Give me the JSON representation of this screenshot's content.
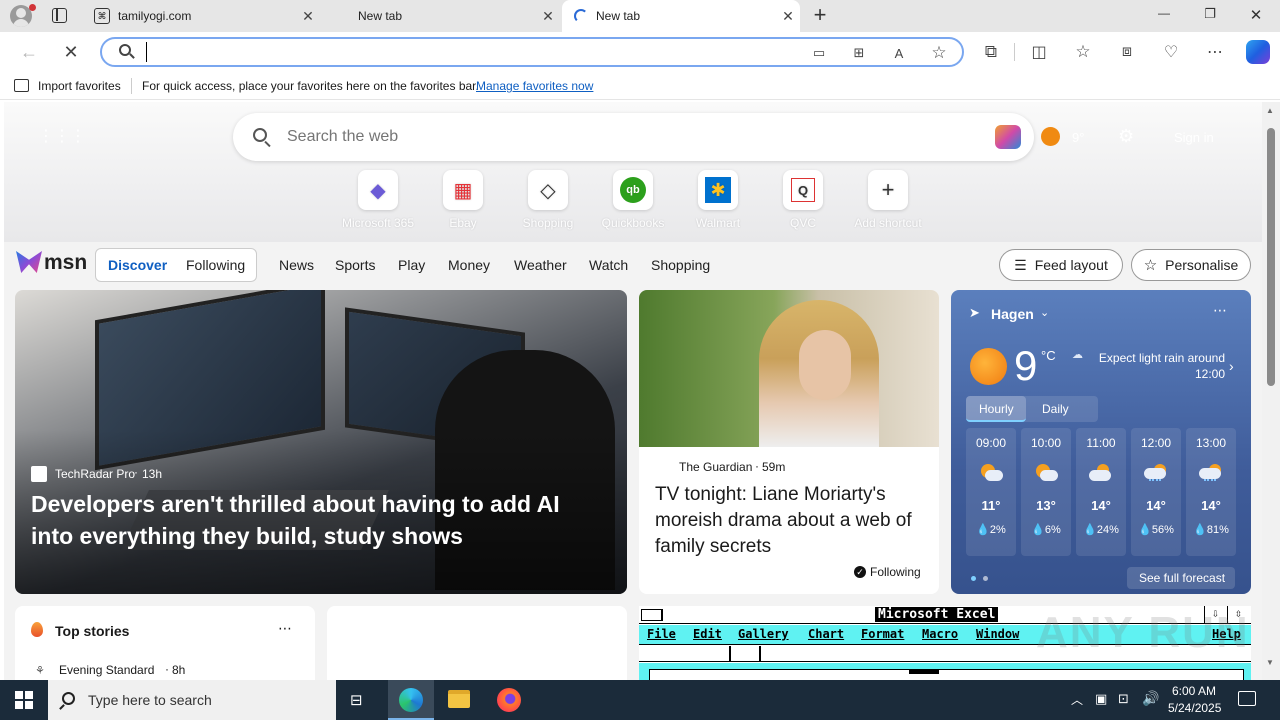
{
  "tabs": [
    {
      "title": "tamilyogi.com"
    },
    {
      "title": "New tab"
    },
    {
      "title": "New tab"
    }
  ],
  "window_controls": {
    "minimize": "—",
    "restore": "❐",
    "close": "✕"
  },
  "address_bar": {
    "value": "",
    "placeholder": ""
  },
  "favorites_bar": {
    "import_label": "Import favorites",
    "hint": "For quick access, place your favorites here on the favorites bar.",
    "manage_link": "Manage favorites now"
  },
  "newtab": {
    "search_placeholder": "Search the web",
    "temp_small": "9°",
    "sign_in": "Sign in",
    "shortcuts": [
      {
        "label": "Microsoft 365",
        "glyph": "◆",
        "color": "#6b5bd6"
      },
      {
        "label": "Ebay",
        "glyph": "▦",
        "color": "#e53238"
      },
      {
        "label": "Shopping",
        "glyph": "◇",
        "color": "#333333"
      },
      {
        "label": "Quickbooks",
        "glyph": "qb",
        "color": "#2ca01c"
      },
      {
        "label": "Walmart",
        "glyph": "✱",
        "color": "#ffc220"
      },
      {
        "label": "QVC",
        "glyph": "Q",
        "color": "#333333"
      },
      {
        "label": "Add shortcut",
        "glyph": "+",
        "color": "#333333"
      }
    ]
  },
  "msn": {
    "logo": "msn",
    "tabs": [
      "Discover",
      "Following"
    ],
    "nav": [
      "News",
      "Sports",
      "Play",
      "Money",
      "Weather",
      "Watch",
      "Shopping"
    ],
    "feed_layout": "Feed layout",
    "personalise": "Personalise"
  },
  "hero_article": {
    "source": "TechRadar Pro",
    "age": "13h",
    "headline": "Developers aren't thrilled about having to add AI into everything they build, study shows"
  },
  "second_article": {
    "source": "The Guardian",
    "age": "59m",
    "headline": "TV tonight: Liane Moriarty's moreish drama about a web of family secrets",
    "follow_label": "Following"
  },
  "weather": {
    "location": "Hagen",
    "temp": "9",
    "unit": "°C",
    "summary": "Expect light rain around 12:00",
    "tabs": [
      "Hourly",
      "Daily"
    ],
    "hours": [
      {
        "time": "09:00",
        "temp": "11°",
        "precip": "2%"
      },
      {
        "time": "10:00",
        "temp": "13°",
        "precip": "6%"
      },
      {
        "time": "11:00",
        "temp": "14°",
        "precip": "24%"
      },
      {
        "time": "12:00",
        "temp": "14°",
        "precip": "56%"
      },
      {
        "time": "13:00",
        "temp": "14°",
        "precip": "81%"
      }
    ],
    "see_full": "See full forecast"
  },
  "top_stories": {
    "title": "Top stories",
    "first_source": "Evening Standard",
    "first_age": "8h"
  },
  "excel_card": {
    "title": "Microsoft Excel",
    "menu": [
      "File",
      "Edit",
      "Gallery",
      "Chart",
      "Format",
      "Macro",
      "Window",
      "Help"
    ]
  },
  "watermark": "ANY RUN",
  "taskbar": {
    "search_placeholder": "Type here to search",
    "time": "6:00 AM",
    "date": "5/24/2025"
  }
}
